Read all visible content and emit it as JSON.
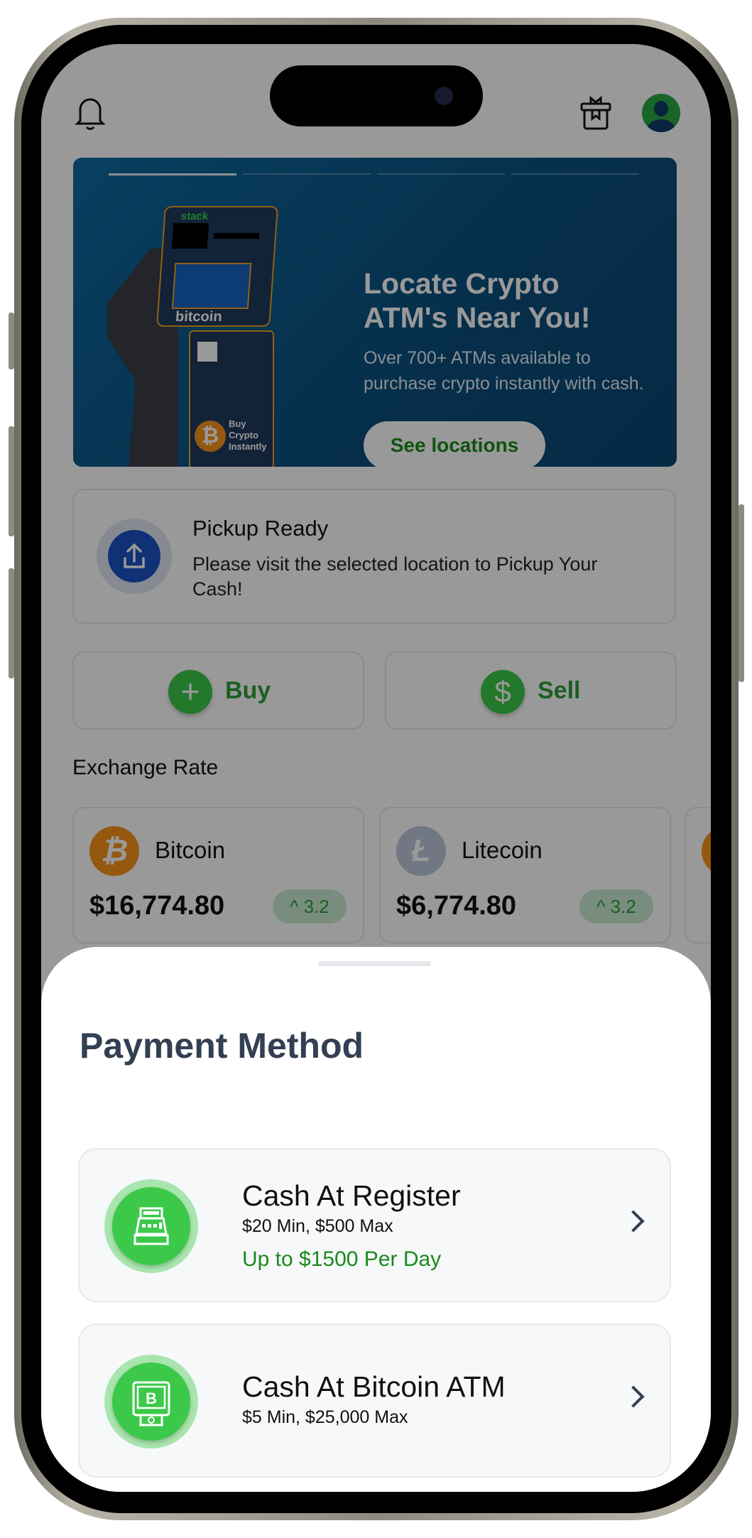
{
  "header": {
    "bell_icon": "bell-icon",
    "gift_icon": "gift-icon",
    "avatar_icon": "user-avatar"
  },
  "banner": {
    "title_line1": "Locate Crypto",
    "title_line2": "ATM's Near You!",
    "subtitle_line1": "Over 700+ ATMs available to",
    "subtitle_line2": "purchase crypto instantly with cash.",
    "button": "See locations",
    "slide_count": 4,
    "active_slide": 1,
    "atm_logo": "stack",
    "atm_brand": "bitcoin",
    "atm_tag": "Buy Crypto Instantly"
  },
  "pickup": {
    "title": "Pickup Ready",
    "description": "Please visit the selected location to Pickup Your Cash!",
    "icon": "upload-icon"
  },
  "actions": {
    "buy": "Buy",
    "sell": "Sell"
  },
  "exchange": {
    "title": "Exchange Rate",
    "coins": [
      {
        "name": "Bitcoin",
        "symbol": "₿",
        "price": "$16,774.80",
        "change": "3.2",
        "color": "#f7931a"
      },
      {
        "name": "Litecoin",
        "symbol": "Ł",
        "price": "$6,774.80",
        "change": "3.2",
        "color": "#bcc8dd"
      }
    ]
  },
  "sheet": {
    "title": "Payment Method",
    "methods": [
      {
        "title": "Cash At Register",
        "limits": "$20 Min, $500 Max",
        "note": "Up to $1500 Per Day",
        "icon": "cash-register-icon"
      },
      {
        "title": "Cash At Bitcoin ATM",
        "limits": "$5 Min, $25,000 Max",
        "icon": "bitcoin-atm-icon"
      }
    ]
  },
  "colors": {
    "green": "#3cc94a",
    "green_text": "#1a8a1a",
    "banner": "#0d5c8e",
    "heading": "#333f52"
  }
}
